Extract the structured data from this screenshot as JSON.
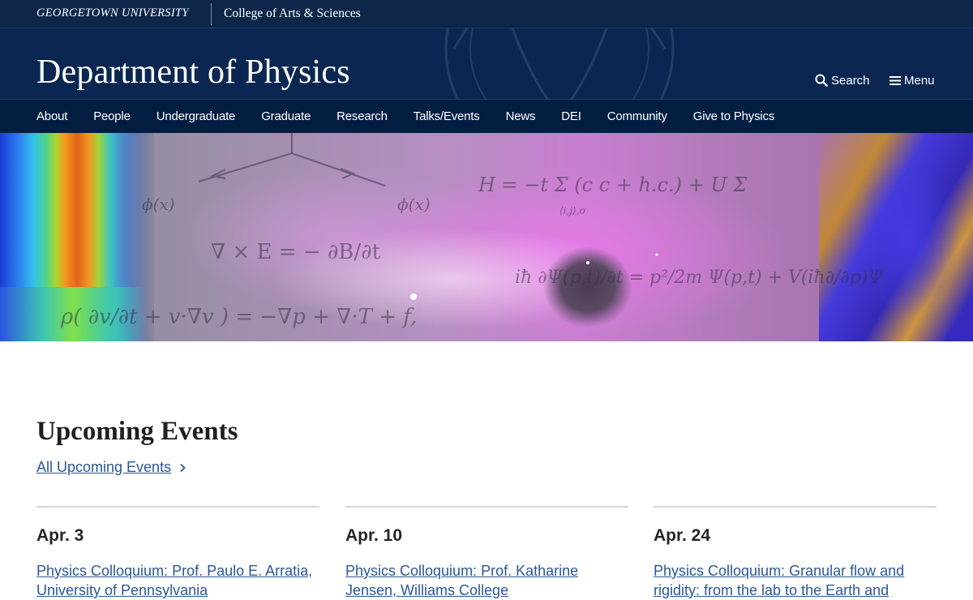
{
  "header": {
    "university": "GEORGETOWN UNIVERSITY",
    "college": "College of Arts & Sciences",
    "department": "Department of Physics",
    "search_label": "Search",
    "menu_label": "Menu",
    "icons": {
      "search": "magnifier-icon",
      "menu": "hamburger-icon"
    }
  },
  "nav": {
    "items": [
      {
        "label": "About"
      },
      {
        "label": "People"
      },
      {
        "label": "Undergraduate"
      },
      {
        "label": "Graduate"
      },
      {
        "label": "Research"
      },
      {
        "label": "Talks/Events"
      },
      {
        "label": "News"
      },
      {
        "label": "DEI"
      },
      {
        "label": "Community"
      },
      {
        "label": "Give to Physics"
      }
    ]
  },
  "events": {
    "heading": "Upcoming Events",
    "all_link": "All Upcoming Events",
    "items": [
      {
        "date": "Apr. 3",
        "title": "Physics Colloquium: Prof. Paulo E. Arratia, University of Pennsylvania"
      },
      {
        "date": "Apr. 10",
        "title": "Physics Colloquium: Prof. Katharine Jensen, Williams College"
      },
      {
        "date": "Apr. 24",
        "title": "Physics Colloquium: Granular flow and rigidity: from the lab to the Earth and"
      }
    ]
  },
  "colors": {
    "header_bg": "#0b2751",
    "nav_bg": "#041e42",
    "link": "#2b5798",
    "divider": "#d9d6cc"
  }
}
